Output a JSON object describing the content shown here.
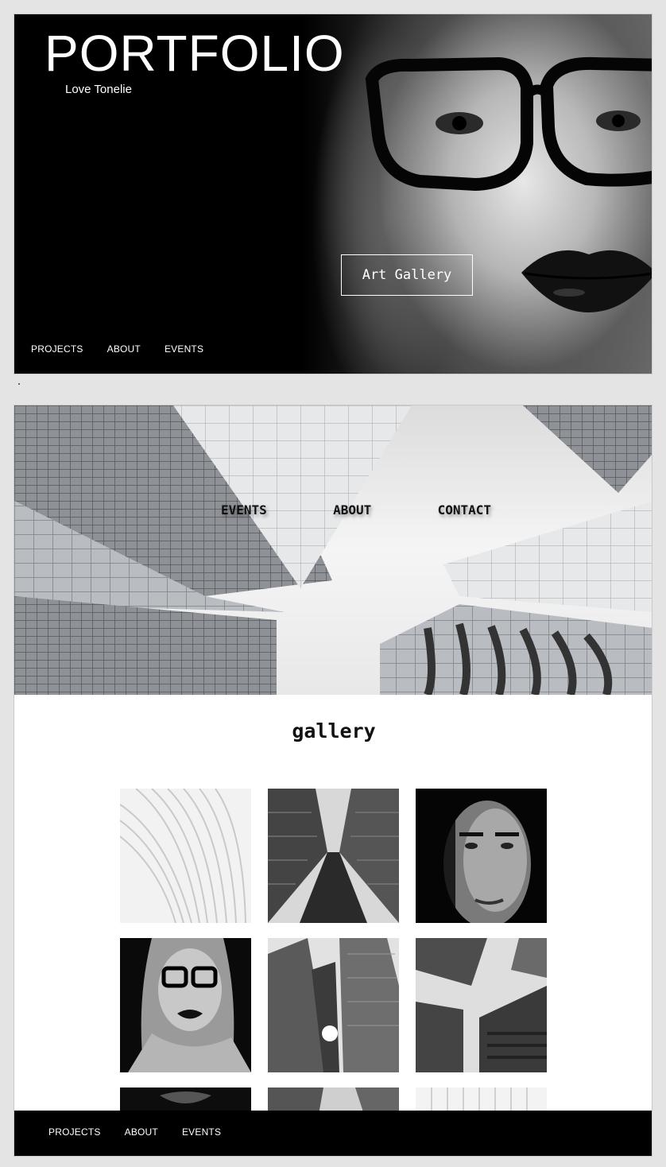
{
  "hero": {
    "title": "PORTFOLIO",
    "subtitle": "Love Tonelie",
    "cta_label": "Art Gallery",
    "nav": [
      "PROJECTS",
      "ABOUT",
      "EVENTS"
    ]
  },
  "page2": {
    "nav": [
      "EVENTS",
      "ABOUT",
      "CONTACT"
    ],
    "gallery_title": "gallery",
    "gallery_items": [
      "curved-white-architecture",
      "skyscrapers-looking-up",
      "man-portrait",
      "woman-glasses-portrait",
      "towers-sun-flare",
      "towers-converging",
      "lips-closeup",
      "tower-corner",
      "white-lines-architecture"
    ],
    "footer_nav": [
      "PROJECTS",
      "ABOUT",
      "EVENTS"
    ]
  },
  "colors": {
    "hero_background": "#000000",
    "page_background": "#e4e4e4",
    "footer_background": "#000000",
    "text_light": "#ffffff",
    "text_dark": "#111111"
  }
}
